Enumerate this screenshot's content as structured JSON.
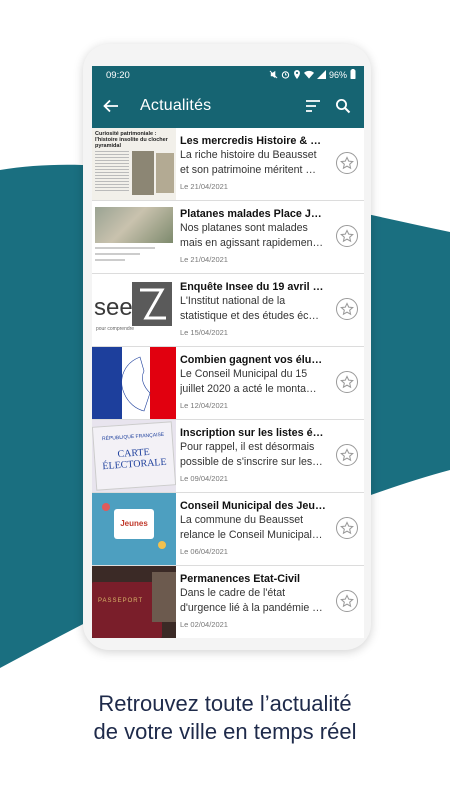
{
  "status_bar": {
    "time": "09:20",
    "battery": "96%",
    "icons": [
      "mute-icon",
      "alarm-icon",
      "location-icon",
      "wifi-icon",
      "signal-icon",
      "battery-icon"
    ]
  },
  "app_bar": {
    "title": "Actualités",
    "back_icon": "arrow-back-icon",
    "sort_icon": "sort-icon",
    "search_icon": "search-icon"
  },
  "news": [
    {
      "title": "Les mercredis Histoire & Patrim…",
      "desc": "La riche histoire du Beausset et son patrimoine méritent …",
      "date": "Le 21/04/2021",
      "thumb_text": "Curiosité patrimoniale : l'histoire insolite du clocher pyramidal"
    },
    {
      "title": "Platanes malades   Place Jean …",
      "desc": "Nos platanes sont malades mais en agissant rapidemen…",
      "date": "Le 21/04/2021"
    },
    {
      "title": "Enquête Insee du 19 avril au 26 j…",
      "desc": "L'Institut national de la statistique et des études éc…",
      "date": "Le 15/04/2021",
      "thumb_text": "see",
      "thumb_sub": "pour comprendre"
    },
    {
      "title": "Combien gagnent vos élus ?",
      "desc": "Le Conseil Municipal du 15 juillet 2020 a acté le monta…",
      "date": "Le 12/04/2021"
    },
    {
      "title": "Inscription sur les listes électora…",
      "desc": "Pour rappel, il est désormais possible de s'inscrire sur les…",
      "date": "Le 09/04/2021",
      "thumb_text": "CARTE ÉLECTORALE",
      "thumb_sub": "RÉPUBLIQUE FRANÇAISE"
    },
    {
      "title": "Conseil Municipal des Jeunes",
      "desc": "La commune du Beausset relance le Conseil Municipal…",
      "date": "Le 06/04/2021",
      "thumb_text": "Jeunes"
    },
    {
      "title": "Permanences Etat-Civil",
      "desc": "Dans le cadre de l'état d'urgence lié à la pandémie …",
      "date": "Le 02/04/2021",
      "thumb_text": "PASSEPORT"
    }
  ],
  "caption": {
    "line1": "Retrouvez toute l’actualité",
    "line2": "de votre ville en temps réel"
  },
  "colors": {
    "primary": "#166472",
    "wave": "#1a6f80",
    "caption": "#1e2a4a"
  }
}
